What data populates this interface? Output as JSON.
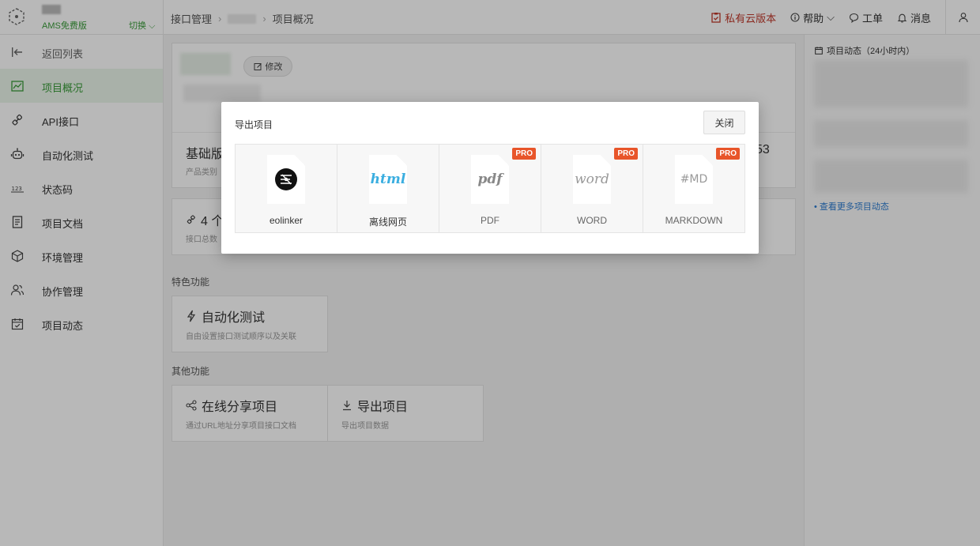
{
  "header": {
    "edition": "AMS免费版",
    "switch_label": "切换",
    "breadcrumb": {
      "first": "接口管理",
      "last": "项目概况"
    },
    "private_cloud": "私有云版本",
    "help": "帮助",
    "ticket": "工单",
    "messages": "消息"
  },
  "sidebar": {
    "items": [
      {
        "label": "返回列表",
        "icon": "back-icon"
      },
      {
        "label": "项目概况",
        "icon": "chart-icon"
      },
      {
        "label": "API接口",
        "icon": "link-icon"
      },
      {
        "label": "自动化测试",
        "icon": "robot-icon"
      },
      {
        "label": "状态码",
        "icon": "code-icon"
      },
      {
        "label": "项目文档",
        "icon": "document-icon"
      },
      {
        "label": "环境管理",
        "icon": "cube-icon"
      },
      {
        "label": "协作管理",
        "icon": "users-icon"
      },
      {
        "label": "项目动态",
        "icon": "calendar-icon"
      }
    ]
  },
  "main": {
    "edit_label": "修改",
    "stat_version": "基础版",
    "stat_version_sub": "产品类别",
    "stat_right_digits": "53",
    "api_count": "4 个",
    "api_count_sub": "接口总数",
    "featured_title": "特色功能",
    "auto_test_title": "自动化测试",
    "auto_test_desc": "自由设置接口测试顺序以及关联",
    "other_title": "其他功能",
    "share_title": "在线分享项目",
    "share_desc": "通过URL地址分享项目接口文档",
    "export_title": "导出项目",
    "export_desc": "导出项目数据"
  },
  "right_panel": {
    "title": "项目动态（24小时内）",
    "more_link": "查看更多项目动态"
  },
  "modal": {
    "title": "导出项目",
    "close_label": "关闭",
    "pro_badge": "PRO",
    "options": [
      {
        "label": "eolinker",
        "icon_text": "",
        "pro": false
      },
      {
        "label": "离线网页",
        "icon_text": "html",
        "pro": false
      },
      {
        "label": "PDF",
        "icon_text": "pdf",
        "pro": true
      },
      {
        "label": "WORD",
        "icon_text": "word",
        "pro": true
      },
      {
        "label": "MARKDOWN",
        "icon_text": "#MD",
        "pro": true
      }
    ]
  },
  "colors": {
    "accent_green": "#3a9c3a",
    "pro_orange": "#e8552a",
    "html_blue": "#3aaee0",
    "link_blue": "#2b7bd0",
    "private_red": "#c0392b"
  }
}
